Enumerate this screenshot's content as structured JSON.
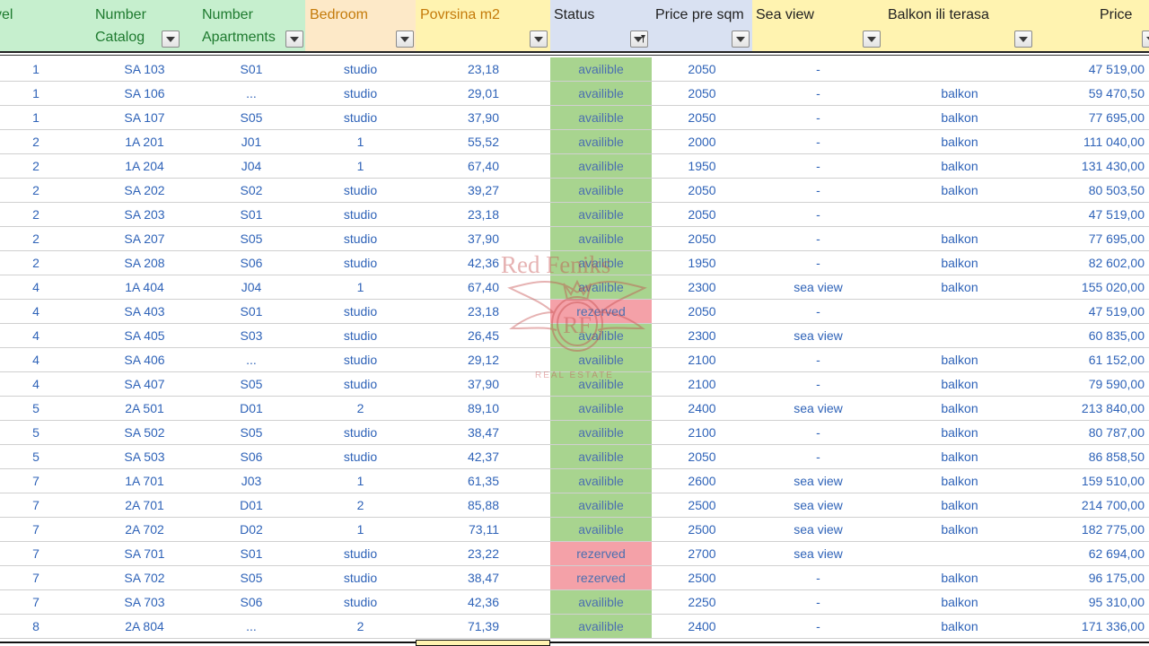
{
  "colors": {
    "green_header": "#c6efce",
    "orange_header": "#fde9c8",
    "blue_header": "#d9e1f2",
    "yellow_header": "#fff3b0",
    "green_text": "#1e7a2f",
    "orange_text": "#c47a0a",
    "availible_fill": "#a8d48f",
    "rezerved_fill": "#f4a1a8",
    "cell_text": "#2f63b8"
  },
  "headers": [
    {
      "key": "level",
      "line1": "vel",
      "line2": ""
    },
    {
      "key": "number_catalog",
      "line1": "Number",
      "line2": "Catalog"
    },
    {
      "key": "number_apartments",
      "line1": "Number",
      "line2": "Apartments"
    },
    {
      "key": "bedroom",
      "line1": "Bedroom",
      "line2": ""
    },
    {
      "key": "povrsina",
      "line1": "Povrsina m2",
      "line2": ""
    },
    {
      "key": "status",
      "line1": "Status",
      "line2": ""
    },
    {
      "key": "price_sqm",
      "line1": "Price pre sqm",
      "line2": ""
    },
    {
      "key": "sea_view",
      "line1": "Sea view",
      "line2": ""
    },
    {
      "key": "balkon",
      "line1": "Balkon ili terasa",
      "line2": ""
    },
    {
      "key": "price",
      "line1": "Price",
      "line2": ""
    }
  ],
  "rows": [
    [
      "1",
      "SA 103",
      "S01",
      "studio",
      "23,18",
      "availible",
      "2050",
      "-",
      "",
      "47 519,00"
    ],
    [
      "1",
      "SA 106",
      "...",
      "studio",
      "29,01",
      "availible",
      "2050",
      "-",
      "balkon",
      "59 470,50"
    ],
    [
      "1",
      "SA 107",
      "S05",
      "studio",
      "37,90",
      "availible",
      "2050",
      "-",
      "balkon",
      "77 695,00"
    ],
    [
      "2",
      "1A 201",
      "J01",
      "1",
      "55,52",
      "availible",
      "2000",
      "-",
      "balkon",
      "111 040,00"
    ],
    [
      "2",
      "1A 204",
      "J04",
      "1",
      "67,40",
      "availible",
      "1950",
      "-",
      "balkon",
      "131 430,00"
    ],
    [
      "2",
      "SA 202",
      "S02",
      "studio",
      "39,27",
      "availible",
      "2050",
      "-",
      "balkon",
      "80 503,50"
    ],
    [
      "2",
      "SA 203",
      "S01",
      "studio",
      "23,18",
      "availible",
      "2050",
      "-",
      "",
      "47 519,00"
    ],
    [
      "2",
      "SA 207",
      "S05",
      "studio",
      "37,90",
      "availible",
      "2050",
      "-",
      "balkon",
      "77 695,00"
    ],
    [
      "2",
      "SA 208",
      "S06",
      "studio",
      "42,36",
      "availible",
      "1950",
      "-",
      "balkon",
      "82 602,00"
    ],
    [
      "4",
      "1A 404",
      "J04",
      "1",
      "67,40",
      "availible",
      "2300",
      "sea view",
      "balkon",
      "155 020,00"
    ],
    [
      "4",
      "SA 403",
      "S01",
      "studio",
      "23,18",
      "rezerved",
      "2050",
      "-",
      "",
      "47 519,00"
    ],
    [
      "4",
      "SA 405",
      "S03",
      "studio",
      "26,45",
      "availible",
      "2300",
      "sea view",
      "",
      "60 835,00"
    ],
    [
      "4",
      "SA 406",
      "...",
      "studio",
      "29,12",
      "availible",
      "2100",
      "-",
      "balkon",
      "61 152,00"
    ],
    [
      "4",
      "SA 407",
      "S05",
      "studio",
      "37,90",
      "availible",
      "2100",
      "-",
      "balkon",
      "79 590,00"
    ],
    [
      "5",
      "2A 501",
      "D01",
      "2",
      "89,10",
      "availible",
      "2400",
      "sea view",
      "balkon",
      "213 840,00"
    ],
    [
      "5",
      "SA 502",
      "S05",
      "studio",
      "38,47",
      "availible",
      "2100",
      "-",
      "balkon",
      "80 787,00"
    ],
    [
      "5",
      "SA 503",
      "S06",
      "studio",
      "42,37",
      "availible",
      "2050",
      "-",
      "balkon",
      "86 858,50"
    ],
    [
      "7",
      "1A 701",
      "J03",
      "1",
      "61,35",
      "availible",
      "2600",
      "sea view",
      "balkon",
      "159 510,00"
    ],
    [
      "7",
      "2A 701",
      "D01",
      "2",
      "85,88",
      "availible",
      "2500",
      "sea view",
      "balkon",
      "214 700,00"
    ],
    [
      "7",
      "2A 702",
      "D02",
      "1",
      "73,11",
      "availible",
      "2500",
      "sea view",
      "balkon",
      "182 775,00"
    ],
    [
      "7",
      "SA 701",
      "S01",
      "studio",
      "23,22",
      "rezerved",
      "2700",
      "sea view",
      "",
      "62 694,00"
    ],
    [
      "7",
      "SA 702",
      "S05",
      "studio",
      "38,47",
      "rezerved",
      "2500",
      "-",
      "balkon",
      "96 175,00"
    ],
    [
      "7",
      "SA 703",
      "S06",
      "studio",
      "42,36",
      "availible",
      "2250",
      "-",
      "balkon",
      "95 310,00"
    ],
    [
      "8",
      "2A 804",
      "...",
      "2",
      "71,39",
      "availible",
      "2400",
      "-",
      "balkon",
      "171 336,00"
    ]
  ],
  "watermark": {
    "title": "Red Feniks",
    "subtitle": "REAL ESTATE",
    "emblem_letters": "RF"
  },
  "filter_icons": {
    "dropdown": "chevron-down-icon",
    "active_filter": "filter-funnel-icon"
  }
}
